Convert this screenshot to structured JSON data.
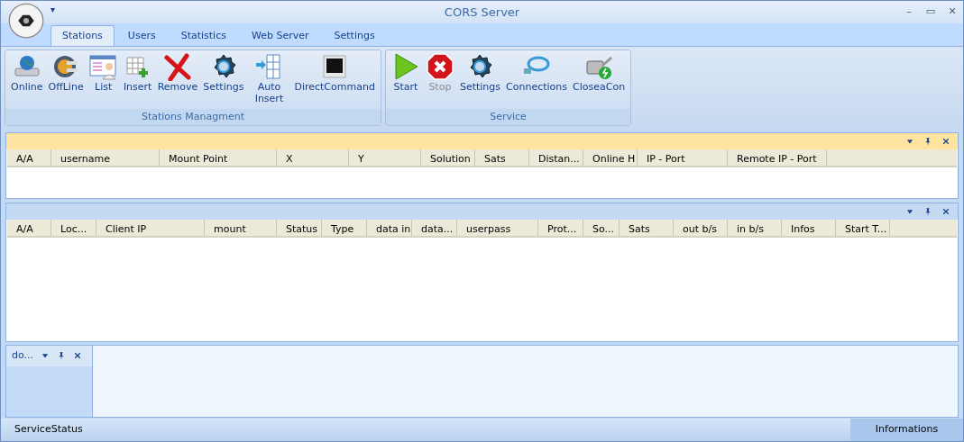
{
  "window": {
    "title": "CORS Server"
  },
  "quick_access": "▾",
  "window_controls": [
    "–",
    "▭",
    "✕"
  ],
  "tabs": [
    {
      "label": "Stations",
      "selected": true
    },
    {
      "label": "Users",
      "selected": false
    },
    {
      "label": "Statistics",
      "selected": false
    },
    {
      "label": "Web Server",
      "selected": false
    },
    {
      "label": "Settings",
      "selected": false
    }
  ],
  "ribbon_groups": [
    {
      "title": "Stations Managment",
      "buttons": [
        {
          "label": "Online",
          "disabled": false
        },
        {
          "label": "OffLine",
          "disabled": false
        },
        {
          "label": "List",
          "disabled": false
        },
        {
          "label": "Insert",
          "disabled": false
        },
        {
          "label": "Remove",
          "disabled": false
        },
        {
          "label": "Settings",
          "disabled": false
        },
        {
          "label": "Auto Insert",
          "disabled": false
        },
        {
          "label": "DirectCommand",
          "disabled": false
        }
      ]
    },
    {
      "title": "Service",
      "buttons": [
        {
          "label": "Start",
          "disabled": false
        },
        {
          "label": "Stop",
          "disabled": true
        },
        {
          "label": "Settings",
          "disabled": false
        },
        {
          "label": "Connections",
          "disabled": false
        },
        {
          "label": "CloseaCon",
          "disabled": false
        }
      ]
    }
  ],
  "stations_panel": {
    "active": true,
    "columns": [
      "A/A",
      "username",
      "Mount Point",
      "X",
      "Y",
      "Solution",
      "Sats",
      "Distan...",
      "Online  H",
      "IP - Port",
      "Remote IP - Port"
    ]
  },
  "clients_panel": {
    "active": false,
    "columns": [
      "A/A",
      "Loc...",
      "Client IP",
      "mount",
      "Status",
      "Type",
      "data in",
      "data...",
      "userpass",
      "Prot...",
      "So...",
      "Sats",
      "out b/s",
      "in b/s",
      "Infos",
      "Start T..."
    ]
  },
  "dock_panel": {
    "title": "do..."
  },
  "status_bar": {
    "left": "ServiceStatus",
    "right": "Informations"
  }
}
